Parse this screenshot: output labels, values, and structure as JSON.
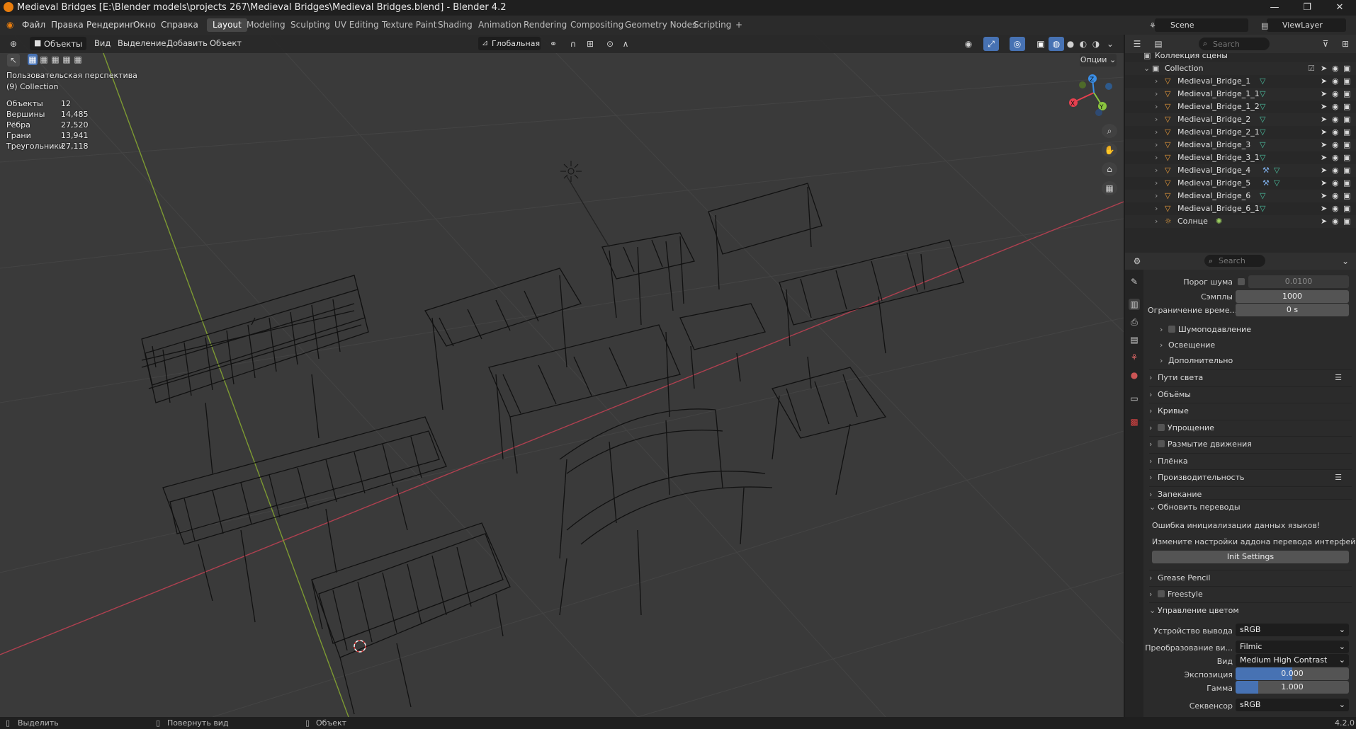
{
  "window": {
    "title": "Medieval Bridges [E:\\Blender models\\projects 267\\Medieval Bridges\\Medieval Bridges.blend] - Blender 4.2",
    "controls": [
      "—",
      "❐",
      "✕"
    ]
  },
  "menu": {
    "items": [
      "Файл",
      "Правка",
      "Рендеринг",
      "Окно",
      "Справка"
    ],
    "workspaces": [
      "Layout",
      "Modeling",
      "Sculpting",
      "UV Editing",
      "Texture Paint",
      "Shading",
      "Animation",
      "Rendering",
      "Compositing",
      "Geometry Nodes",
      "Scripting"
    ],
    "active_workspace": "Layout",
    "add_tab": "+",
    "scene": "Scene",
    "view_layer": "ViewLayer"
  },
  "viewport_header": {
    "mode": "Объекты",
    "menus": [
      "Вид",
      "Выделение",
      "Добавить",
      "Объект"
    ],
    "transform_orientation": "Глобальная",
    "options_label": "Опции"
  },
  "overlay": {
    "view_name": "Пользовательская перспектива",
    "collection": "(9) Collection",
    "stats": [
      {
        "label": "Объекты",
        "value": "12"
      },
      {
        "label": "Вершины",
        "value": "14,485"
      },
      {
        "label": "Рёбра",
        "value": "27,520"
      },
      {
        "label": "Грани",
        "value": "13,941"
      },
      {
        "label": "Треугольники",
        "value": "27,118"
      }
    ]
  },
  "gizmo": {
    "x": "X",
    "y": "Y",
    "z": "Z",
    "colors": {
      "x": "#e8404f",
      "y": "#8bc53f",
      "z": "#3a8ee6"
    }
  },
  "outliner": {
    "search_placeholder": "Search",
    "root": "Коллекция сцены",
    "collection": "Collection",
    "items": [
      {
        "name": "Medieval_Bridge_1",
        "mod": false
      },
      {
        "name": "Medieval_Bridge_1_1",
        "mod": false
      },
      {
        "name": "Medieval_Bridge_1_2",
        "mod": false
      },
      {
        "name": "Medieval_Bridge_2",
        "mod": false
      },
      {
        "name": "Medieval_Bridge_2_1",
        "mod": false
      },
      {
        "name": "Medieval_Bridge_3",
        "mod": false
      },
      {
        "name": "Medieval_Bridge_3_1",
        "mod": false
      },
      {
        "name": "Medieval_Bridge_4",
        "mod": true
      },
      {
        "name": "Medieval_Bridge_5",
        "mod": true
      },
      {
        "name": "Medieval_Bridge_6",
        "mod": false
      },
      {
        "name": "Medieval_Bridge_6_1",
        "mod": false
      },
      {
        "name": "Солнце",
        "mod": false
      }
    ]
  },
  "properties": {
    "search_placeholder": "Search",
    "noise_threshold_label": "Порог шума",
    "noise_threshold_value": "0.0100",
    "samples_label": "Сэмплы",
    "samples_value": "1000",
    "time_limit_label": "Ограничение време...",
    "time_limit_value": "0 s",
    "subsections": [
      "Шумоподавление",
      "Освещение",
      "Дополнительно"
    ],
    "sections": [
      {
        "label": "Пути света",
        "check": false,
        "list": true
      },
      {
        "label": "Объёмы",
        "check": false,
        "list": false
      },
      {
        "label": "Кривые",
        "check": false,
        "list": false
      },
      {
        "label": "Упрощение",
        "check": true,
        "list": false
      },
      {
        "label": "Размытие движения",
        "check": true,
        "list": false
      },
      {
        "label": "Плёнка",
        "check": false,
        "list": false
      },
      {
        "label": "Производительность",
        "check": false,
        "list": true
      },
      {
        "label": "Запекание",
        "check": false,
        "list": false
      }
    ],
    "update_translations": {
      "title": "Обновить переводы",
      "error": "Ошибка инициализации данных языков!",
      "hint": "Измените настройки аддона перевода интерфейса",
      "button": "Init Settings"
    },
    "grease_pencil": "Grease Pencil",
    "freestyle": "Freestyle",
    "color_management": {
      "title": "Управление цветом",
      "display_device_label": "Устройство вывода",
      "display_device": "sRGB",
      "view_transform_label": "Преобразование ви...",
      "view_transform": "Filmic",
      "look_label": "Вид",
      "look": "Medium High Contrast",
      "exposure_label": "Экспозиция",
      "exposure": "0.000",
      "gamma_label": "Гамма",
      "gamma": "1.000",
      "sequencer_label": "Секвенсор",
      "sequencer": "sRGB"
    }
  },
  "statusbar": {
    "select": "Выделить",
    "rotate": "Повернуть вид",
    "object": "Объект",
    "version": "4.2.0"
  }
}
